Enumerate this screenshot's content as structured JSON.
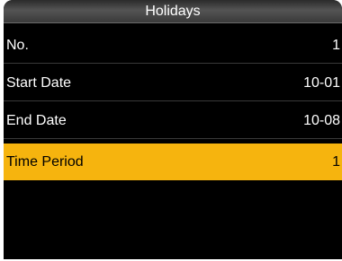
{
  "header": {
    "title": "Holidays"
  },
  "colors": {
    "background": "#000000",
    "highlight": "#f6b40e",
    "text": "#ffffff"
  },
  "rows": [
    {
      "label": "No.",
      "value": "1",
      "selected": false
    },
    {
      "label": "Start Date",
      "value": "10-01",
      "selected": false
    },
    {
      "label": "End Date",
      "value": "10-08",
      "selected": false
    },
    {
      "label": "Time Period",
      "value": "1",
      "selected": true
    }
  ]
}
